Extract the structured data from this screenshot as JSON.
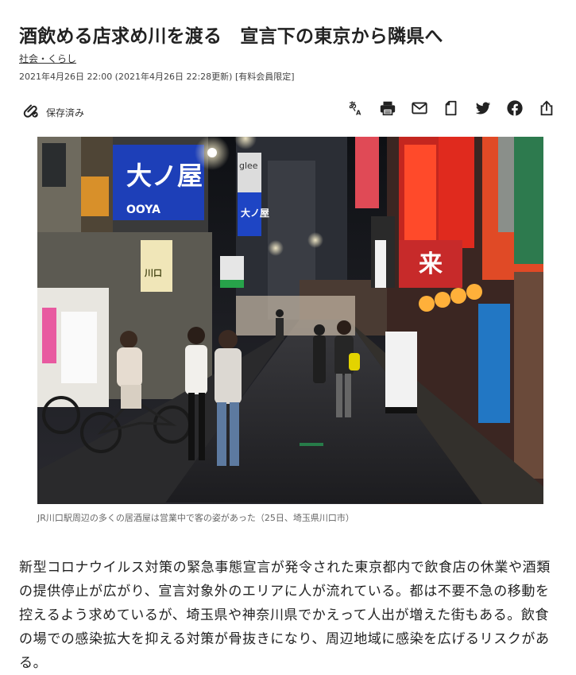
{
  "article": {
    "headline": "酒飲める店求め川を渡る　宣言下の東京から隣県へ",
    "category": "社会・くらし",
    "meta": "2021年4月26日 22:00 (2021年4月26日 22:28更新) [有料会員限定]"
  },
  "toolbar": {
    "saved_label": "保存済み",
    "tools": [
      {
        "icon": "font-size-icon"
      },
      {
        "icon": "print-icon"
      },
      {
        "icon": "mail-icon"
      },
      {
        "icon": "bookmark-icon"
      },
      {
        "icon": "twitter-icon"
      },
      {
        "icon": "facebook-icon"
      },
      {
        "icon": "share-icon"
      }
    ]
  },
  "photo": {
    "caption": "JR川口駅周辺の多くの居酒屋は営業中で客の姿があった（25日、埼玉県川口市）",
    "signs": {
      "left_big": "大ノ屋",
      "left_small_roman": "OOYA",
      "center_sign": "大ノ屋",
      "tower": "glee",
      "right_big": "来",
      "kawaguchi": "川口"
    }
  },
  "body": {
    "text": "新型コロナウイルス対策の緊急事態宣言が発令された東京都内で飲食店の休業や酒類の提供停止が広がり、宣言対象外のエリアに人が流れている。都は不要不急の移動を控えるよう求めているが、埼玉県や神奈川県でかえって人出が増えた街もある。飲食の場での感染拡大を抑える対策が骨抜きになり、周辺地域に感染を広げるリスクがある。"
  },
  "colors": {
    "text": "#222222",
    "meta": "#444444",
    "caption": "#666666"
  }
}
